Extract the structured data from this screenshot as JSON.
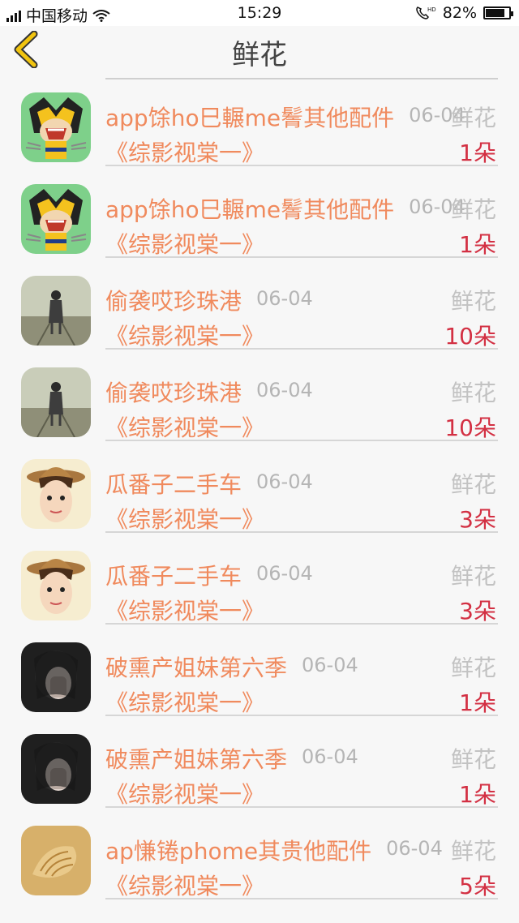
{
  "status": {
    "carrier": "中国移动",
    "time": "15:29",
    "battery": "82%",
    "battery_level": 0.82,
    "network": "4G"
  },
  "nav": {
    "title": "鲜花"
  },
  "rows": [
    {
      "name": "app馀ho巳輾me鬌其他配件",
      "date": "06-04",
      "tag": "鲜花",
      "show": "《综影视棠一》",
      "count": "1朵",
      "avatar": "wolverine-cartoon"
    },
    {
      "name": "app馀ho巳輾me鬌其他配件",
      "date": "06-04",
      "tag": "鲜花",
      "show": "《综影视棠一》",
      "count": "1朵",
      "avatar": "wolverine-cartoon"
    },
    {
      "name": "偷袭哎珍珠港",
      "date": "06-04",
      "tag": "鲜花",
      "show": "《综影视棠一》",
      "count": "10朵",
      "avatar": "girl-on-road"
    },
    {
      "name": "偷袭哎珍珠港",
      "date": "06-04",
      "tag": "鲜花",
      "show": "《综影视棠一》",
      "count": "10朵",
      "avatar": "girl-on-road"
    },
    {
      "name": "瓜番子二手车",
      "date": "06-04",
      "tag": "鲜花",
      "show": "《综影视棠一》",
      "count": "3朵",
      "avatar": "boy-with-hat"
    },
    {
      "name": "瓜番子二手车",
      "date": "06-04",
      "tag": "鲜花",
      "show": "《综影视棠一》",
      "count": "3朵",
      "avatar": "boy-with-hat"
    },
    {
      "name": "破熏产姐妹第六季",
      "date": "06-04",
      "tag": "鲜花",
      "show": "《综影视棠一》",
      "count": "1朵",
      "avatar": "dark-portrait"
    },
    {
      "name": "破熏产姐妹第六季",
      "date": "06-04",
      "tag": "鲜花",
      "show": "《综影视棠一》",
      "count": "1朵",
      "avatar": "dark-portrait"
    },
    {
      "name": "ap慊锩phome其贵他配件",
      "date": "06-04",
      "tag": "鲜花",
      "show": "《综影视棠一》",
      "count": "5朵",
      "avatar": "seashell"
    }
  ]
}
